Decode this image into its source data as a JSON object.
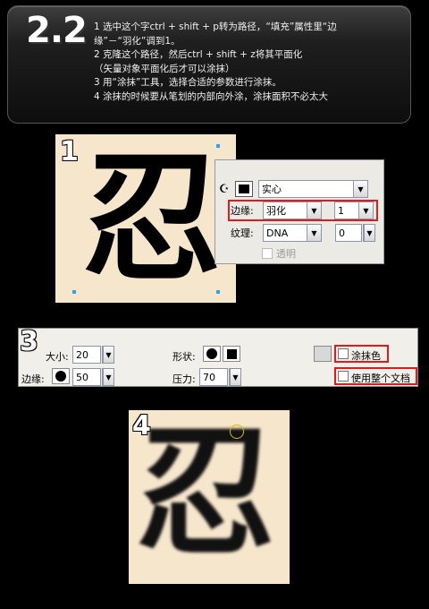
{
  "header": {
    "step_number": "2.2",
    "lines": [
      "1 选中这个字ctrl + shift + p转为路径，“填充”属性里“边",
      "缘”－“羽化”调到1。",
      "2 克隆这个路径，然后ctrl + shift + z将其平面化",
      "（矢量对象平面化后才可以涂抹）",
      "3 用“涂抹”工具，选择合适的参数进行涂抹。",
      "4 涂抹的时候要从笔划的内部向外涂，涂抹面积不必太大"
    ]
  },
  "panel1": {
    "badge": "1",
    "glyph": "忍",
    "fill_props": {
      "fill_type": "实心",
      "edge_label": "边缘:",
      "edge_value": "羽化",
      "edge_amount": "1",
      "texture_label": "纹理:",
      "texture_value": "DNA",
      "texture_amount": "0",
      "transparent_label": "透明"
    }
  },
  "panel3": {
    "badge": "3",
    "size_label": "大小:",
    "size_value": "20",
    "edge_label": "边缘:",
    "edge_value": "50",
    "shape_label": "形状:",
    "pressure_label": "压力:",
    "pressure_value": "70",
    "smudge_color_label": "涂抹色",
    "use_whole_doc_label": "使用整个文档"
  },
  "panel4": {
    "badge": "4",
    "glyph": "忍"
  },
  "colors": {
    "background": "#000000",
    "canvas": "#f6e6cc",
    "highlight": "#e01b1b",
    "selection_handle": "#2aa3ff"
  }
}
